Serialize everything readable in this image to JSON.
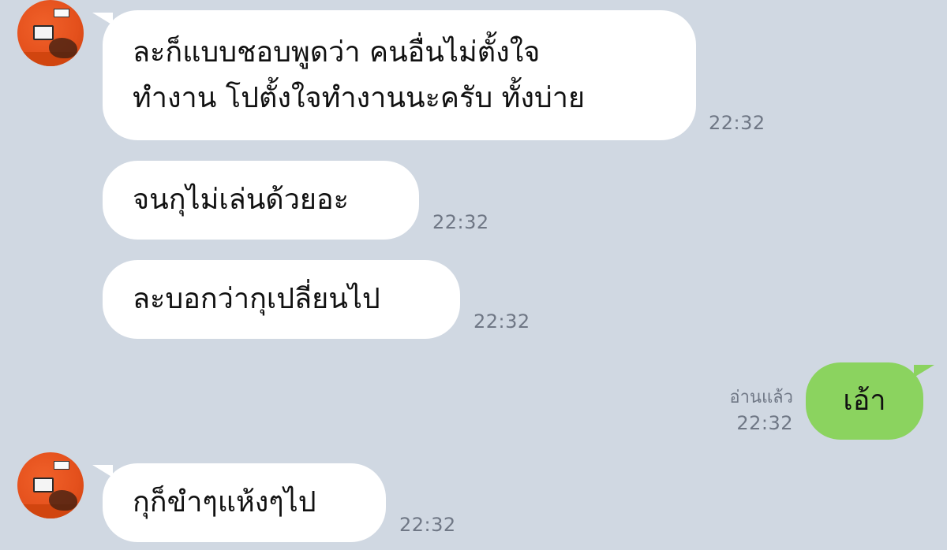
{
  "messages": [
    {
      "sender": "other",
      "lines": [
        "ละก็แบบชอบพูดว่า คนอื่นไม่ตั้งใจ",
        "ทำงาน โปตั้งใจทำงานนะครับ ทั้งบ่าย"
      ],
      "time": "22:32"
    },
    {
      "sender": "other",
      "lines": [
        "จนกุไม่เล่นด้วยอะ"
      ],
      "time": "22:32"
    },
    {
      "sender": "other",
      "lines": [
        "ละบอกว่ากุเปลี่ยนไป"
      ],
      "time": "22:32"
    },
    {
      "sender": "me",
      "lines": [
        "เอ้า"
      ],
      "read_label": "อ่านแล้ว",
      "time": "22:32"
    },
    {
      "sender": "other",
      "lines": [
        "กุก็ขำๆแห้งๆไป"
      ],
      "time": "22:32"
    }
  ],
  "colors": {
    "background": "#d0d8e2",
    "incoming_bubble": "#ffffff",
    "outgoing_bubble": "#8bd35f",
    "meta_text": "#6f7785",
    "avatar": "#e4501c"
  }
}
